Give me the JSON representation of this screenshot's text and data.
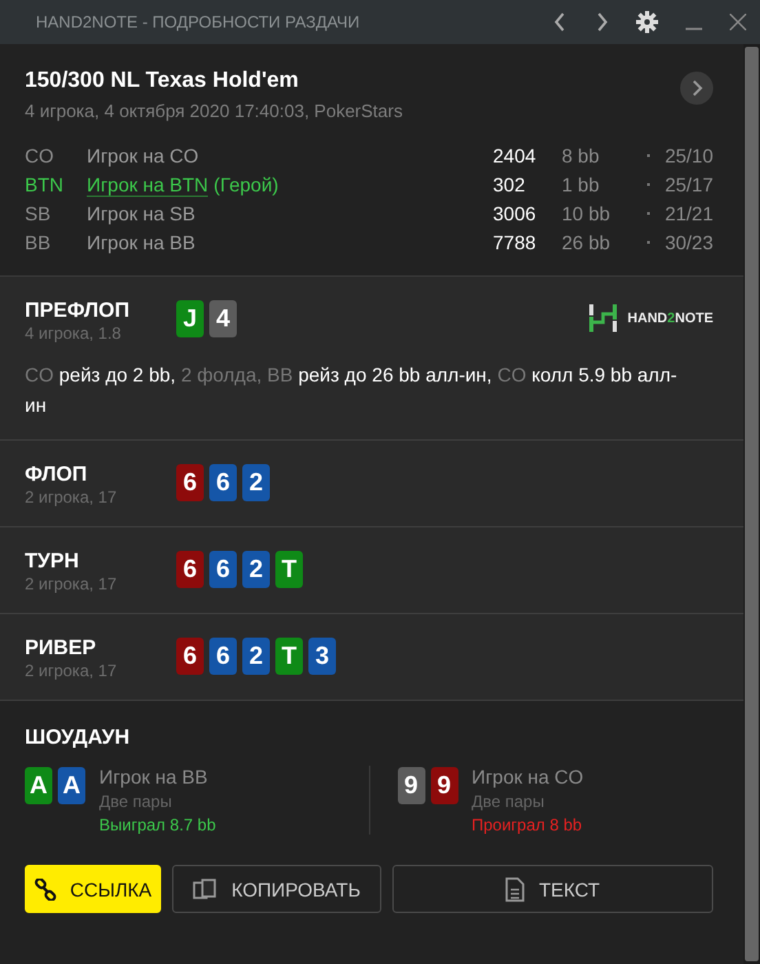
{
  "window": {
    "title": "HAND2NOTE - ПОДРОБНОСТИ РАЗДАЧИ"
  },
  "hand": {
    "title": "150/300 NL Texas Hold'em",
    "subtitle": "4 игрока, 4 октября 2020 17:40:03, PokerStars"
  },
  "players": [
    {
      "position": "CO",
      "name": "Игрок на CO",
      "hero": false,
      "stack": "2404",
      "bb": "8 bb",
      "stat": "25/10"
    },
    {
      "position": "BTN",
      "name": "Игрок на BTN",
      "hero": true,
      "hero_label": "(Герой)",
      "stack": "302",
      "bb": "1 bb",
      "stat": "25/17"
    },
    {
      "position": "SB",
      "name": "Игрок на SB",
      "hero": false,
      "stack": "3006",
      "bb": "10 bb",
      "stat": "21/21"
    },
    {
      "position": "BB",
      "name": "Игрок на BB",
      "hero": false,
      "stack": "7788",
      "bb": "26 bb",
      "stat": "30/23"
    }
  ],
  "streets": [
    {
      "name": "ПРЕФЛОП",
      "info": "4 игрока, 1.8",
      "cards": [
        {
          "rank": "J",
          "color": "#0f8a17"
        },
        {
          "rank": "4",
          "color": "#5c5c5c"
        }
      ],
      "logo": {
        "left": "HAND",
        "mid": "2",
        "right": "NOTE"
      },
      "actions": "CO **рейз до 2 bb,** 2 фолда, BB **рейз до 26 bb алл-ин,** CO **колл 5.9 bb алл-ин**"
    },
    {
      "name": "ФЛОП",
      "info": "2 игрока, 17",
      "cards": [
        {
          "rank": "6",
          "color": "#8e0b0b"
        },
        {
          "rank": "6",
          "color": "#1556a8"
        },
        {
          "rank": "2",
          "color": "#1556a8"
        }
      ]
    },
    {
      "name": "ТУРН",
      "info": "2 игрока, 17",
      "cards": [
        {
          "rank": "6",
          "color": "#8e0b0b"
        },
        {
          "rank": "6",
          "color": "#1556a8"
        },
        {
          "rank": "2",
          "color": "#1556a8"
        },
        {
          "rank": "T",
          "color": "#0f8a17"
        }
      ]
    },
    {
      "name": "РИВЕР",
      "info": "2 игрока, 17",
      "cards": [
        {
          "rank": "6",
          "color": "#8e0b0b"
        },
        {
          "rank": "6",
          "color": "#1556a8"
        },
        {
          "rank": "2",
          "color": "#1556a8"
        },
        {
          "rank": "T",
          "color": "#0f8a17"
        },
        {
          "rank": "3",
          "color": "#1556a8"
        }
      ]
    }
  ],
  "showdown": {
    "title": "ШОУДАУН",
    "players": [
      {
        "cards": [
          {
            "rank": "A",
            "color": "#0f8a17"
          },
          {
            "rank": "A",
            "color": "#1556a8"
          }
        ],
        "name": "Игрок на BB",
        "hand": "Две пары",
        "result": "Выиграл 8.7 bb",
        "won": true
      },
      {
        "cards": [
          {
            "rank": "9",
            "color": "#5c5c5c"
          },
          {
            "rank": "9",
            "color": "#8e0b0b"
          }
        ],
        "name": "Игрок на CO",
        "hand": "Две пары",
        "result": "Проиграл 8 bb",
        "won": false
      }
    ]
  },
  "buttons": [
    {
      "label": "ССЫЛКА",
      "kind": "link",
      "primary": true
    },
    {
      "label": "КОПИРОВАТЬ",
      "kind": "copy",
      "primary": false
    },
    {
      "label": "ТЕКСТ",
      "kind": "text",
      "primary": false
    }
  ]
}
